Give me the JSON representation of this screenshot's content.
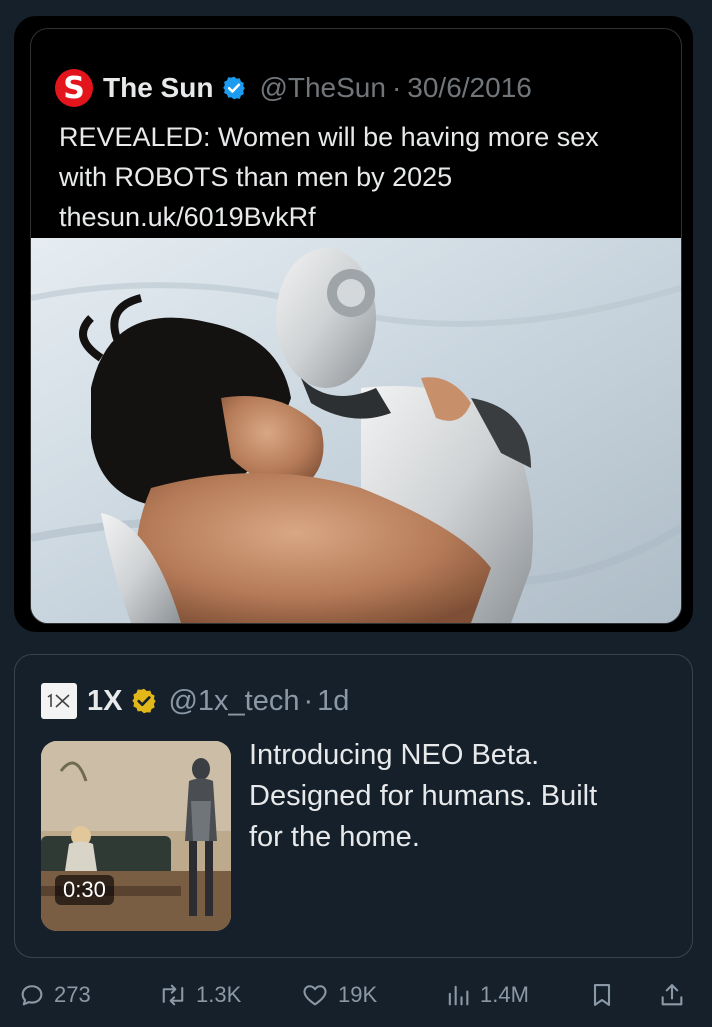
{
  "quoted_original": {
    "logo_letter": "S",
    "name": "The Sun",
    "handle": "@TheSun",
    "separator": "·",
    "date": "30/6/2016",
    "text_lines": [
      "REVEALED: Women will be having more sex",
      "with ROBOTS than men by 2025",
      "thesun.uk/6019BvkRf"
    ],
    "image_icon": "photo-robot-embrace"
  },
  "quoted_tweet": {
    "logo_text": "1X",
    "name": "1X",
    "handle": "@1x_tech",
    "separator": "·",
    "age": "1d",
    "text_lines": [
      "Introducing NEO Beta.",
      "Designed for humans. Built",
      "for the home."
    ],
    "video_duration": "0:30"
  },
  "actions": {
    "replies": "273",
    "reposts": "1.3K",
    "likes": "19K",
    "views": "1.4M"
  },
  "colors": {
    "background": "#15202b",
    "muted": "#8b98a5",
    "verified_blue": "#1d9bf0",
    "verified_gold": "#e2b719",
    "sun_red": "#e4141c"
  }
}
